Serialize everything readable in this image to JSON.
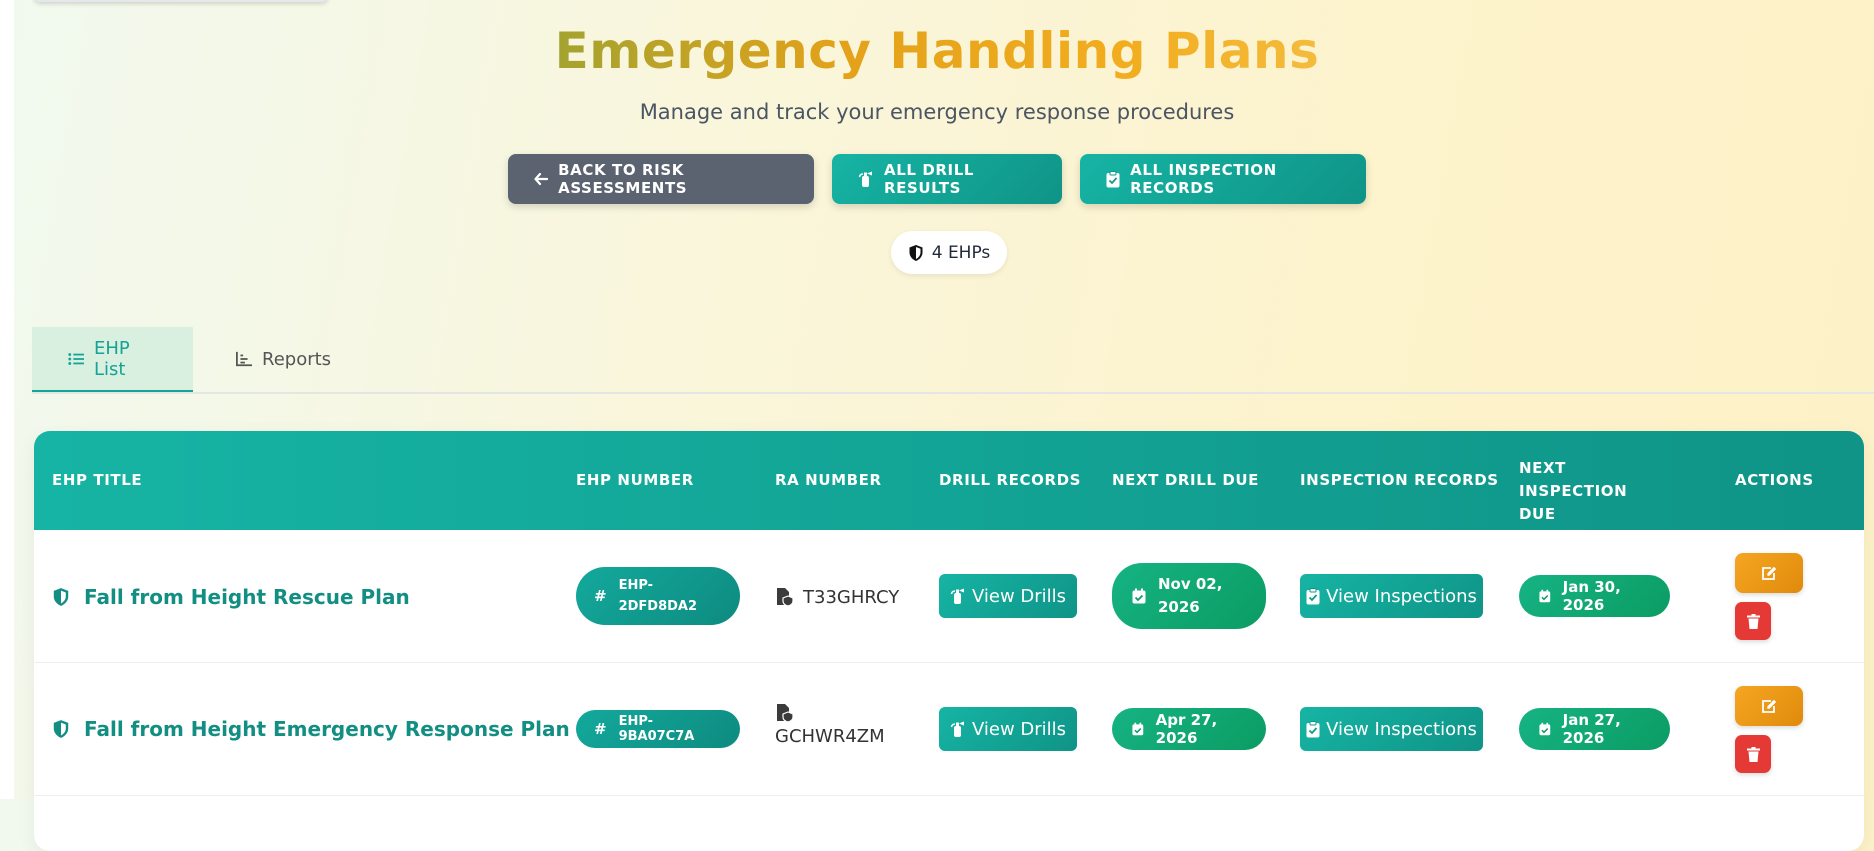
{
  "header": {
    "title": "Emergency Handling Plans",
    "subtitle": "Manage and track your emergency response procedures",
    "buttons": {
      "back": "BACK TO RISK ASSESSMENTS",
      "drills": "ALL DRILL RESULTS",
      "inspections": "ALL INSPECTION RECORDS"
    },
    "count": "4 EHPs"
  },
  "tabs": [
    {
      "label": "EHP List",
      "active": true
    },
    {
      "label": "Reports",
      "active": false
    }
  ],
  "table": {
    "columns": [
      "EHP TITLE",
      "EHP NUMBER",
      "RA NUMBER",
      "DRILL RECORDS",
      "NEXT DRILL DUE",
      "INSPECTION RECORDS",
      "NEXT INSPECTION DUE",
      "ACTIONS"
    ],
    "rows": [
      {
        "title": "Fall from Height Rescue Plan",
        "ehp_number": "EHP-2DFD8DA2",
        "ra_number": "T33GHRCY",
        "drills_label": "View Drills",
        "next_drill": "Nov 02, 2026",
        "inspections_label": "View Inspections",
        "next_inspection": "Jan 30, 2026"
      },
      {
        "title": "Fall from Height Emergency Response Plan",
        "ehp_number": "EHP-9BA07C7A",
        "ra_number": "GCHWR4ZM",
        "drills_label": "View Drills",
        "next_drill": "Apr 27, 2026",
        "inspections_label": "View Inspections",
        "next_inspection": "Jan 27, 2026"
      }
    ]
  },
  "colors": {
    "teal": "#14a394",
    "green": "#0b9c63",
    "orange": "#f5a623",
    "red": "#e53935",
    "gray_button": "#5b6270"
  }
}
